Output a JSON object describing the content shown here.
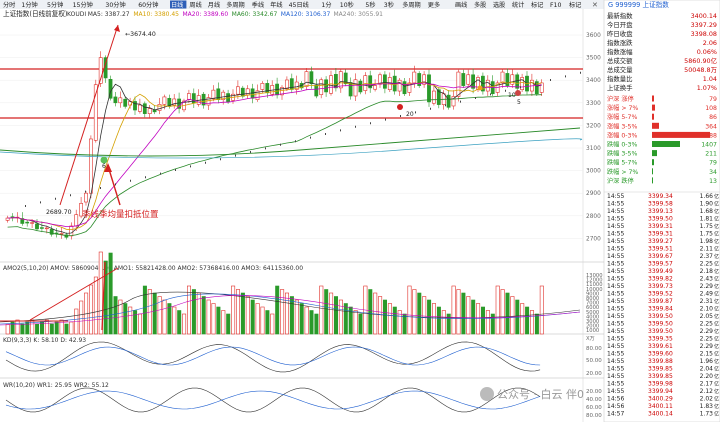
{
  "toolbar": {
    "tabs": [
      "分时",
      "1分钟",
      "5分钟",
      "15分钟",
      "30分钟",
      "60分钟",
      "日线",
      "周线",
      "月线",
      "多周期",
      "季线",
      "年线",
      "45日线",
      "1分",
      "10秒",
      "5秒",
      "3秒",
      "多周期",
      "更多"
    ],
    "active_tab": "日线",
    "right_buttons": [
      "画线",
      "多股",
      "选股",
      "统计",
      "标记",
      "F10",
      "标记"
    ]
  },
  "chart": {
    "title": "上证指数(日线前复权)",
    "ma_line": [
      {
        "text": "KOUDI",
        "color": "#333333"
      },
      {
        "text": "MA5: 3387.27",
        "color": "#333333"
      },
      {
        "text": "MA10: 3380.45",
        "color": "#d4a000"
      },
      {
        "text": "MA20: 3389.60",
        "color": "#c000c0"
      },
      {
        "text": "MA60: 3342.67",
        "color": "#2a8a2a"
      },
      {
        "text": "MA120: 3106.37",
        "color": "#2060d0"
      },
      {
        "text": "MA240: 3055.91",
        "color": "#888888"
      }
    ],
    "price_axis": [
      "3600",
      "3500",
      "3400",
      "3300",
      "3200",
      "3100",
      "3000",
      "2900",
      "2800",
      "2700"
    ],
    "high_label": "3674.40",
    "low_label": "2689.70",
    "markers": [
      "10",
      "5",
      "20",
      "6"
    ],
    "annotation": "季线季均量扣抵位置",
    "volume_title": "AMO2(5,10,20)  AMOV: 58609040.00  AMO1: 55821428.00  AMO2: 57368416.00  AMO3: 64115360.00",
    "volume_axis": [
      "13000",
      "12000",
      "11000",
      "10000",
      "9000",
      "8000",
      "7000",
      "6000",
      "5000",
      "4000",
      "3000",
      "2000",
      "1000"
    ],
    "volume_unit": "X万",
    "kdj_title": "KD(9,3,3)  K: 58.10  D: 42.93",
    "kdj_axis": [
      "80.00",
      "50.00",
      "20.00"
    ],
    "wr_title": "WR(10,20)  WR1: 25.95  WR2: 55.12",
    "wr_axis": [
      "20.00",
      "40.00",
      "60.00",
      "80.00"
    ],
    "watermark": "公众号 · 白云 伴0"
  },
  "quote": {
    "header": "G  999999  上证指数",
    "stats": [
      {
        "k": "最新指数",
        "v": "3400.14"
      },
      {
        "k": "今日开盘",
        "v": "3397.29"
      },
      {
        "k": "昨日收盘",
        "v": "3398.08"
      },
      {
        "k": "指数涨跌",
        "v": "2.06"
      },
      {
        "k": "指数涨幅",
        "v": "0.06%"
      },
      {
        "k": "总成交额",
        "v": "5860.90亿"
      },
      {
        "k": "总成交量",
        "v": "50048.8万"
      },
      {
        "k": "指数量比",
        "v": "1.04"
      },
      {
        "k": "上证换手",
        "v": "1.07%"
      }
    ],
    "breadth": [
      {
        "k": "沪深 涨停",
        "v": "79",
        "w": 2,
        "c": "#e0302a"
      },
      {
        "k": "涨幅 > 7%",
        "v": "108",
        "w": 3,
        "c": "#e0302a"
      },
      {
        "k": "涨幅 5-7%",
        "v": "86",
        "w": 2,
        "c": "#e0302a"
      },
      {
        "k": "涨幅 3-5%",
        "v": "364",
        "w": 7,
        "c": "#e0302a"
      },
      {
        "k": "涨幅 0-3%",
        "v": "2988",
        "w": 58,
        "c": "#e0302a"
      },
      {
        "k": "跌幅 0-3%",
        "v": "1407",
        "w": 28,
        "c": "#2a9a2a"
      },
      {
        "k": "跌幅 3-5%",
        "v": "211",
        "w": 5,
        "c": "#2a9a2a"
      },
      {
        "k": "跌幅 5-7%",
        "v": "79",
        "w": 2,
        "c": "#2a9a2a"
      },
      {
        "k": "跌幅 > 7%",
        "v": "34",
        "w": 1,
        "c": "#2a9a2a"
      },
      {
        "k": "沪深 跌停",
        "v": "13",
        "w": 1,
        "c": "#2a9a2a"
      }
    ],
    "ticks": [
      {
        "t": "14:55",
        "p": "3399.34",
        "q": "1.66"
      },
      {
        "t": "14:55",
        "p": "3399.58",
        "q": "1.90"
      },
      {
        "t": "14:55",
        "p": "3399.13",
        "q": "1.68"
      },
      {
        "t": "14:55",
        "p": "3399.50",
        "q": "1.81"
      },
      {
        "t": "14:55",
        "p": "3399.31",
        "q": "1.75"
      },
      {
        "t": "14:55",
        "p": "3399.31",
        "q": "1.75"
      },
      {
        "t": "14:55",
        "p": "3399.27",
        "q": "1.98"
      },
      {
        "t": "14:55",
        "p": "3399.51",
        "q": "2.11"
      },
      {
        "t": "14:55",
        "p": "3399.67",
        "q": "2.37"
      },
      {
        "t": "14:55",
        "p": "3399.57",
        "q": "2.25"
      },
      {
        "t": "14:55",
        "p": "3399.49",
        "q": "2.18"
      },
      {
        "t": "14:55",
        "p": "3399.82",
        "q": "2.43"
      },
      {
        "t": "14:55",
        "p": "3399.73",
        "q": "2.29"
      },
      {
        "t": "14:55",
        "p": "3399.52",
        "q": "2.49"
      },
      {
        "t": "14:55",
        "p": "3399.87",
        "q": "2.31"
      },
      {
        "t": "14:55",
        "p": "3399.84",
        "q": "2.10"
      },
      {
        "t": "14:55",
        "p": "3399.50",
        "q": "2.05"
      },
      {
        "t": "14:55",
        "p": "3399.50",
        "q": "2.25"
      },
      {
        "t": "14:55",
        "p": "3399.50",
        "q": "2.29"
      },
      {
        "t": "14:55",
        "p": "3399.35",
        "q": "2.25"
      },
      {
        "t": "14:55",
        "p": "3399.61",
        "q": "2.29"
      },
      {
        "t": "14:55",
        "p": "3399.60",
        "q": "2.15"
      },
      {
        "t": "14:55",
        "p": "3399.88",
        "q": "1.96"
      },
      {
        "t": "14:55",
        "p": "3399.85",
        "q": "2.04"
      },
      {
        "t": "14:55",
        "p": "3399.85",
        "q": "2.20"
      },
      {
        "t": "14:55",
        "p": "3399.98",
        "q": "2.17"
      },
      {
        "t": "14:55",
        "p": "3399.94",
        "q": "2.12"
      },
      {
        "t": "14:56",
        "p": "3400.29",
        "q": "2.02"
      },
      {
        "t": "14:56",
        "p": "3400.11",
        "q": "1.83"
      },
      {
        "t": "14:57",
        "p": "3400.14",
        "q": "1.73"
      }
    ]
  },
  "colors": {
    "up": "#e0302a",
    "down": "#2a9a2a",
    "ref": "#d42020"
  }
}
